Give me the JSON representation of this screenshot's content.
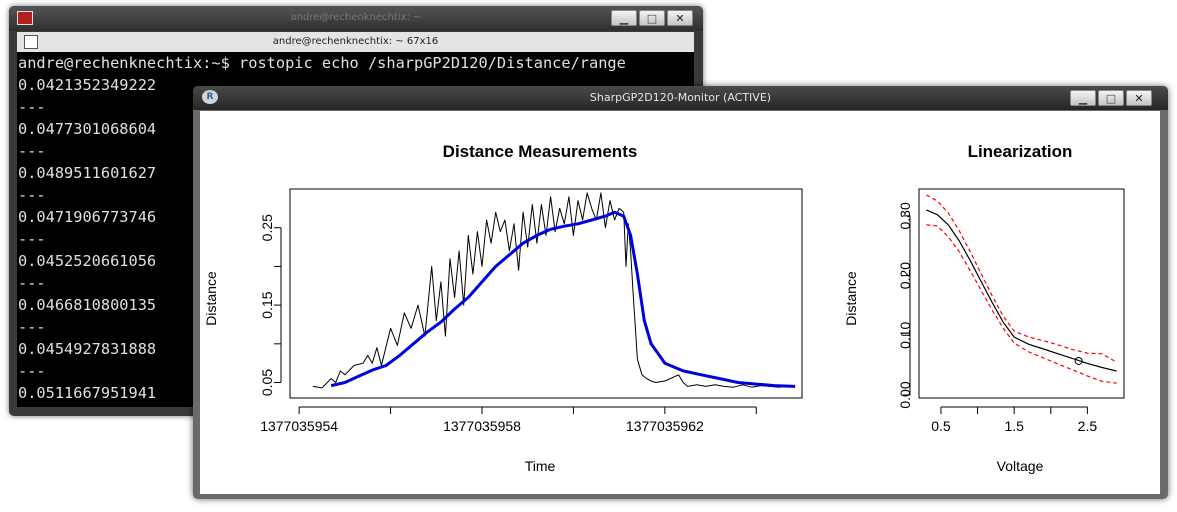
{
  "terminal": {
    "window_title": "andre@rechenknechtix: ~",
    "menu_title": "andre@rechenknechtix: ~ 67x16",
    "lines": [
      "andre@rechenknechtix:~$ rostopic echo /sharpGP2D120/Distance/range",
      "0.0421352349222",
      "---",
      "0.0477301068604",
      "---",
      "0.0489511601627",
      "---",
      "0.0471906773746",
      "---",
      "0.0452520661056",
      "---",
      "0.0466810800135",
      "---",
      "0.0454927831888",
      "---",
      "0.0511667951941"
    ]
  },
  "plot_window": {
    "title": "SharpGP2D120-Monitor (ACTIVE)",
    "colors": {
      "raw": "#000000",
      "smoothed": "#0000dd",
      "band": "#ff0000"
    }
  },
  "window_buttons": {
    "minimize": "▁",
    "maximize": "□",
    "close": "✕"
  },
  "chart_data": [
    {
      "type": "line",
      "title": "Distance Measurements",
      "xlabel": "Time",
      "ylabel": "Distance",
      "xlim": [
        1377035953.8,
        1377035965.0
      ],
      "ylim": [
        0.03,
        0.3
      ],
      "x_ticks": [
        1377035954,
        1377035956,
        1377035958,
        1377035960,
        1377035962,
        1377035964
      ],
      "x_tick_labels": [
        "1377035954",
        "",
        "1377035958",
        "",
        "1377035962",
        ""
      ],
      "y_ticks": [
        0.05,
        0.1,
        0.15,
        0.2,
        0.25
      ],
      "y_tick_labels": [
        "0.05",
        "",
        "0.15",
        "",
        "0.25"
      ],
      "grid": false,
      "series": [
        {
          "color": "#000000",
          "width": 1,
          "x": [
            1377035954.3,
            1377035954.5,
            1377035954.7,
            1377035954.8,
            1377035954.9,
            1377035955.0,
            1377035955.2,
            1377035955.4,
            1377035955.5,
            1377035955.6,
            1377035955.7,
            1377035955.8,
            1377035956.0,
            1377035956.15,
            1377035956.3,
            1377035956.45,
            1377035956.6,
            1377035956.75,
            1377035956.9,
            1377035957.0,
            1377035957.1,
            1377035957.2,
            1377035957.3,
            1377035957.4,
            1377035957.5,
            1377035957.6,
            1377035957.7,
            1377035957.8,
            1377035957.9,
            1377035958.0,
            1377035958.1,
            1377035958.2,
            1377035958.3,
            1377035958.4,
            1377035958.5,
            1377035958.6,
            1377035958.7,
            1377035958.8,
            1377035958.9,
            1377035959.0,
            1377035959.1,
            1377035959.2,
            1377035959.3,
            1377035959.4,
            1377035959.5,
            1377035959.6,
            1377035959.7,
            1377035959.8,
            1377035959.9,
            1377035960.0,
            1377035960.1,
            1377035960.2,
            1377035960.3,
            1377035960.4,
            1377035960.5,
            1377035960.6,
            1377035960.7,
            1377035960.8,
            1377035960.9,
            1377035961.0,
            1377035961.1,
            1377035961.15,
            1377035961.2,
            1377035961.25,
            1377035961.3,
            1377035961.4,
            1377035961.5,
            1377035961.6,
            1377035961.7,
            1377035961.8,
            1377035962.0,
            1377035962.3,
            1377035962.4,
            1377035962.5,
            1377035962.7,
            1377035962.9,
            1377035963.1,
            1377035963.3,
            1377035963.5,
            1377035963.7,
            1377035963.9,
            1377035964.1,
            1377035964.3,
            1377035964.5,
            1377035964.7,
            1377035964.85
          ],
          "values": [
            0.045,
            0.043,
            0.055,
            0.05,
            0.065,
            0.06,
            0.072,
            0.075,
            0.085,
            0.075,
            0.095,
            0.072,
            0.12,
            0.098,
            0.14,
            0.12,
            0.15,
            0.11,
            0.2,
            0.13,
            0.18,
            0.11,
            0.21,
            0.16,
            0.22,
            0.15,
            0.24,
            0.19,
            0.245,
            0.2,
            0.26,
            0.23,
            0.27,
            0.245,
            0.26,
            0.22,
            0.255,
            0.195,
            0.27,
            0.225,
            0.28,
            0.23,
            0.28,
            0.24,
            0.29,
            0.245,
            0.275,
            0.255,
            0.29,
            0.24,
            0.285,
            0.26,
            0.295,
            0.275,
            0.26,
            0.295,
            0.25,
            0.285,
            0.26,
            0.275,
            0.27,
            0.2,
            0.255,
            0.22,
            0.17,
            0.08,
            0.06,
            0.055,
            0.052,
            0.05,
            0.052,
            0.06,
            0.05,
            0.045,
            0.047,
            0.045,
            0.047,
            0.045,
            0.044,
            0.047,
            0.044,
            0.046,
            0.045,
            0.044,
            0.046,
            0.045
          ]
        },
        {
          "color": "#0000dd",
          "width": 3,
          "x": [
            1377035954.7,
            1377035955.0,
            1377035955.3,
            1377035955.6,
            1377035955.9,
            1377035956.2,
            1377035956.5,
            1377035956.8,
            1377035957.1,
            1377035957.4,
            1377035957.7,
            1377035958.0,
            1377035958.3,
            1377035958.6,
            1377035958.9,
            1377035959.2,
            1377035959.5,
            1377035959.8,
            1377035960.1,
            1377035960.4,
            1377035960.7,
            1377035960.9,
            1377035961.1,
            1377035961.25,
            1377035961.4,
            1377035961.55,
            1377035961.7,
            1377035962.0,
            1377035962.4,
            1377035962.8,
            1377035963.2,
            1377035963.6,
            1377035964.0,
            1377035964.4,
            1377035964.85
          ],
          "values": [
            0.046,
            0.05,
            0.058,
            0.066,
            0.072,
            0.085,
            0.1,
            0.115,
            0.128,
            0.145,
            0.16,
            0.18,
            0.2,
            0.215,
            0.23,
            0.24,
            0.248,
            0.252,
            0.255,
            0.26,
            0.265,
            0.27,
            0.265,
            0.24,
            0.19,
            0.13,
            0.1,
            0.075,
            0.065,
            0.06,
            0.055,
            0.05,
            0.048,
            0.046,
            0.045
          ]
        }
      ]
    },
    {
      "type": "line",
      "title": "Linearization",
      "xlabel": "Voltage",
      "ylabel": "Distance",
      "xlim": [
        0.2,
        3.0
      ],
      "ylim": [
        -0.005,
        0.345
      ],
      "x_ticks": [
        0.5,
        1.0,
        1.5,
        2.0,
        2.5
      ],
      "x_tick_labels": [
        "0.5",
        "",
        "1.5",
        "",
        "2.5"
      ],
      "y_ticks": [
        0.0,
        0.1,
        0.2,
        0.3
      ],
      "y_tick_labels": [
        "0.00",
        "0.10",
        "0.20",
        "0.30"
      ],
      "grid": false,
      "series": [
        {
          "color": "#000000",
          "style": "solid",
          "x": [
            0.3,
            0.45,
            0.6,
            0.75,
            0.9,
            1.05,
            1.2,
            1.35,
            1.5,
            1.7,
            1.9,
            2.1,
            2.3,
            2.5,
            2.7,
            2.9
          ],
          "values": [
            0.31,
            0.302,
            0.285,
            0.258,
            0.225,
            0.19,
            0.155,
            0.122,
            0.097,
            0.085,
            0.077,
            0.069,
            0.061,
            0.053,
            0.046,
            0.04
          ]
        },
        {
          "color": "#ff0000",
          "style": "dashed",
          "x": [
            0.3,
            0.45,
            0.6,
            0.75,
            0.9,
            1.05,
            1.2,
            1.35,
            1.5,
            1.7,
            1.9,
            2.1,
            2.3,
            2.5,
            2.7,
            2.9
          ],
          "values": [
            0.335,
            0.325,
            0.305,
            0.275,
            0.24,
            0.203,
            0.166,
            0.132,
            0.107,
            0.097,
            0.091,
            0.084,
            0.076,
            0.07,
            0.069,
            0.055
          ]
        },
        {
          "color": "#ff0000",
          "style": "dashed",
          "x": [
            0.3,
            0.45,
            0.6,
            0.75,
            0.9,
            1.05,
            1.2,
            1.35,
            1.5,
            1.7,
            1.9,
            2.1,
            2.3,
            2.5,
            2.7,
            2.9
          ],
          "values": [
            0.285,
            0.283,
            0.265,
            0.24,
            0.208,
            0.175,
            0.142,
            0.112,
            0.087,
            0.072,
            0.062,
            0.052,
            0.042,
            0.032,
            0.023,
            0.02
          ]
        }
      ],
      "points": [
        {
          "x": 2.38,
          "y": 0.057
        }
      ]
    }
  ]
}
